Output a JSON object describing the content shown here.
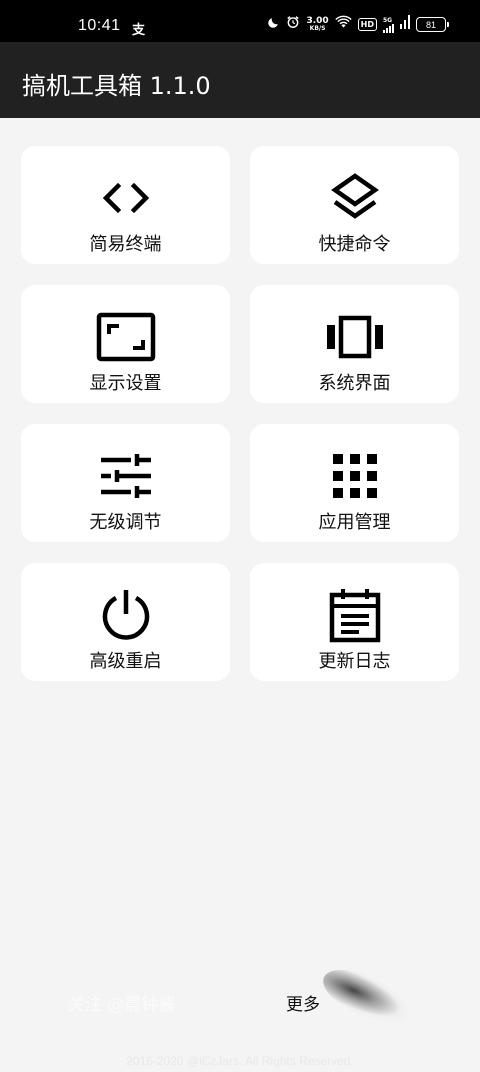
{
  "status_bar": {
    "time": "10:41",
    "alipay_glyph": "支",
    "net_speed_value": "3.00",
    "net_speed_unit": "KB/S",
    "hd_badge": "HD",
    "network_type": "5G",
    "battery_level": "81"
  },
  "app_bar": {
    "title": "搞机工具箱 1.1.0"
  },
  "grid": [
    {
      "label": "简易终端",
      "icon": "code-brackets-icon"
    },
    {
      "label": "快捷命令",
      "icon": "layers-icon"
    },
    {
      "label": "显示设置",
      "icon": "screen-frame-icon"
    },
    {
      "label": "系统界面",
      "icon": "carousel-icon"
    },
    {
      "label": "无级调节",
      "icon": "sliders-icon"
    },
    {
      "label": "应用管理",
      "icon": "apps-grid-icon"
    },
    {
      "label": "高级重启",
      "icon": "power-icon"
    },
    {
      "label": "更新日志",
      "icon": "calendar-notes-icon"
    }
  ],
  "footer": {
    "follow_label": "关注 @晨钟酱",
    "more_label": "更多",
    "copyright": "2016-2020 @iCzJars. All Rights Reserved."
  },
  "colors": {
    "app_bar_bg": "#212121",
    "page_bg": "#f4f4f4",
    "card_bg": "#ffffff",
    "icon_color": "#000000"
  }
}
